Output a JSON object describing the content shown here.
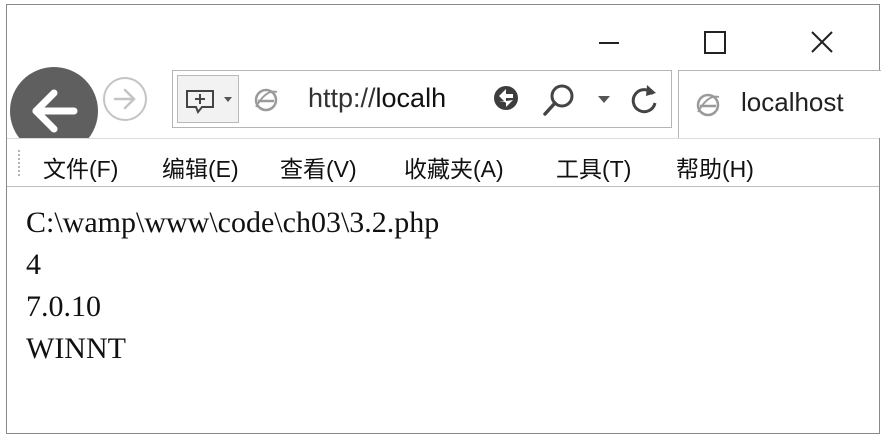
{
  "window_controls": {
    "minimize": "minimize-icon",
    "maximize": "maximize-icon",
    "close": "close-icon"
  },
  "navigation": {
    "back_icon": "back-arrow-icon",
    "forward_icon": "forward-arrow-icon"
  },
  "address_bar": {
    "url_prefix": "http://",
    "url_host": "localh",
    "icons": [
      "compatibility-add-icon",
      "ie-page-icon",
      "compatibility-view-icon",
      "search-icon",
      "dropdown-caret-icon",
      "refresh-icon"
    ]
  },
  "tab": {
    "label": "localhost",
    "icon": "ie-page-icon"
  },
  "menu": {
    "file": "文件(F)",
    "edit": "编辑(E)",
    "view": "查看(V)",
    "favorites": "收藏夹(A)",
    "tools": "工具(T)",
    "help": "帮助(H)"
  },
  "page": {
    "lines": [
      "C:\\wamp\\www\\code\\ch03\\3.2.php",
      "4",
      "7.0.10",
      "WINNT"
    ]
  },
  "colors": {
    "back_button": "#5f5f5f",
    "border": "#b5b5b5",
    "text": "#111111"
  }
}
